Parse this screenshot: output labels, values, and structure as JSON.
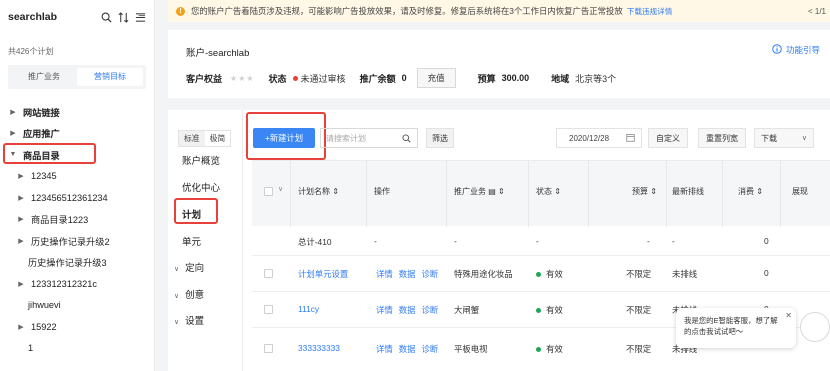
{
  "sidebar": {
    "title": "searchlab",
    "count_text": "共426个计划",
    "tabs": [
      "推广业务",
      "营销目标"
    ],
    "tree": [
      {
        "label": "网站链接",
        "level": 0,
        "caret": "▶",
        "bold": true
      },
      {
        "label": "应用推广",
        "level": 0,
        "caret": "▶",
        "bold": true
      },
      {
        "label": "商品目录",
        "level": 0,
        "caret": "▼",
        "bold": true
      },
      {
        "label": "12345",
        "level": 1,
        "caret": "▶"
      },
      {
        "label": "123456512361234",
        "level": 1,
        "caret": "▶"
      },
      {
        "label": "商品目录1223",
        "level": 1,
        "caret": "▶"
      },
      {
        "label": "历史操作记录升级2",
        "level": 1,
        "caret": "▶"
      },
      {
        "label": "历史操作记录升级3",
        "level": 1,
        "caret": ""
      },
      {
        "label": "123312312321c",
        "level": 1,
        "caret": "▶"
      },
      {
        "label": "jihwuevi",
        "level": 1,
        "caret": ""
      },
      {
        "label": "15922",
        "level": 1,
        "caret": "▶"
      },
      {
        "label": "1",
        "level": 1,
        "caret": ""
      }
    ]
  },
  "warning": {
    "text": "您的账户广告着陆页涉及违规，可能影响广告投放效果，请及时修复。修复后系统将在3个工作日内恢复广告正常投放",
    "link": "下载违规详情",
    "page": "< 1/1"
  },
  "account": {
    "name": "账户-searchlab",
    "help": "功能引导",
    "rights_label": "客户权益",
    "stars": "★★★",
    "status_label": "状态",
    "status_value": "未通过审核",
    "balance_label": "推广余额",
    "balance_value": "0",
    "charge": "充值",
    "budget_label": "预算",
    "budget_value": "300.00",
    "region_label": "地域",
    "region_value": "北京等3个"
  },
  "nav": {
    "mode_tabs": [
      "标准",
      "极简"
    ],
    "items": [
      "账户概览",
      "优化中心",
      "计划",
      "单元"
    ],
    "groups": [
      "定向",
      "创意",
      "设置"
    ]
  },
  "toolbar": {
    "new_plan": "+新建计划",
    "search_placeholder": "请搜索计划",
    "filter": "筛选",
    "date": "2020/12/28",
    "custom": "自定义",
    "reset_cols": "重置列宽",
    "download": "下载"
  },
  "table": {
    "headers": [
      "计划名称 ⇕",
      "操作",
      "推广业务",
      "状态 ⇕",
      "预算 ⇕",
      "最新排线",
      "消费 ⇕",
      "展现"
    ],
    "total": {
      "name": "总计-410",
      "op": "-",
      "biz": "-",
      "status": "-",
      "budget": "-",
      "latest": "-",
      "cost": "0"
    },
    "rows": [
      {
        "name": "计划单元设置",
        "ops": [
          "详情",
          "数据",
          "诊断"
        ],
        "biz": "特殊用途化妆品",
        "status": "有效",
        "budget": "不限定",
        "latest": "未排线",
        "cost": "0"
      },
      {
        "name": "111cy",
        "ops": [
          "详情",
          "数据",
          "诊断"
        ],
        "biz": "大闸蟹",
        "status": "有效",
        "budget": "不限定",
        "latest": "未排线",
        "cost": "0"
      },
      {
        "name": "333333333",
        "ops": [
          "详情",
          "数据",
          "诊断"
        ],
        "biz": "平板电视",
        "status": "有效",
        "budget": "不限定",
        "latest": "未排线",
        "cost": ""
      }
    ]
  },
  "chat": {
    "text": "我是您的E智能客服，想了解的点击我试试吧～",
    "close": "✕"
  },
  "colors": {
    "accent": "#3a86f5",
    "highlight": "#e8413a",
    "success": "#22a559",
    "warning": "#f0a21b"
  }
}
